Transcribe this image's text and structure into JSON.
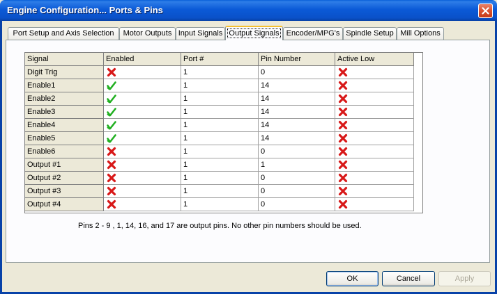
{
  "window": {
    "title": "Engine Configuration... Ports & Pins"
  },
  "tabs": [
    {
      "label": "Port Setup and Axis Selection",
      "active": false
    },
    {
      "label": "Motor Outputs",
      "active": false
    },
    {
      "label": "Input Signals",
      "active": false
    },
    {
      "label": "Output Signals",
      "active": true
    },
    {
      "label": "Encoder/MPG's",
      "active": false
    },
    {
      "label": "Spindle Setup",
      "active": false
    },
    {
      "label": "Mill Options",
      "active": false
    }
  ],
  "table": {
    "columns": [
      "Signal",
      "Enabled",
      "Port #",
      "Pin Number",
      "Active Low"
    ],
    "rows": [
      {
        "signal": "Digit  Trig",
        "enabled": false,
        "port": "1",
        "pin": "0",
        "active_low": false
      },
      {
        "signal": "Enable1",
        "enabled": true,
        "port": "1",
        "pin": "14",
        "active_low": false
      },
      {
        "signal": "Enable2",
        "enabled": true,
        "port": "1",
        "pin": "14",
        "active_low": false
      },
      {
        "signal": "Enable3",
        "enabled": true,
        "port": "1",
        "pin": "14",
        "active_low": false
      },
      {
        "signal": "Enable4",
        "enabled": true,
        "port": "1",
        "pin": "14",
        "active_low": false
      },
      {
        "signal": "Enable5",
        "enabled": true,
        "port": "1",
        "pin": "14",
        "active_low": false
      },
      {
        "signal": "Enable6",
        "enabled": false,
        "port": "1",
        "pin": "0",
        "active_low": false
      },
      {
        "signal": "Output #1",
        "enabled": false,
        "port": "1",
        "pin": "1",
        "active_low": false
      },
      {
        "signal": "Output #2",
        "enabled": false,
        "port": "1",
        "pin": "0",
        "active_low": false
      },
      {
        "signal": "Output #3",
        "enabled": false,
        "port": "1",
        "pin": "0",
        "active_low": false
      },
      {
        "signal": "Output #4",
        "enabled": false,
        "port": "1",
        "pin": "0",
        "active_low": false
      }
    ]
  },
  "note": "Pins 2 - 9 , 1, 14, 16, and 17 are output pins.  No  other pin numbers should be used.",
  "buttons": {
    "ok": "OK",
    "cancel": "Cancel",
    "apply": "Apply"
  },
  "colors": {
    "title_bar": "#0a51c9",
    "check_icon": "#22b022",
    "cross_icon": "#d81818",
    "dialog_bg": "#ece9d8"
  }
}
